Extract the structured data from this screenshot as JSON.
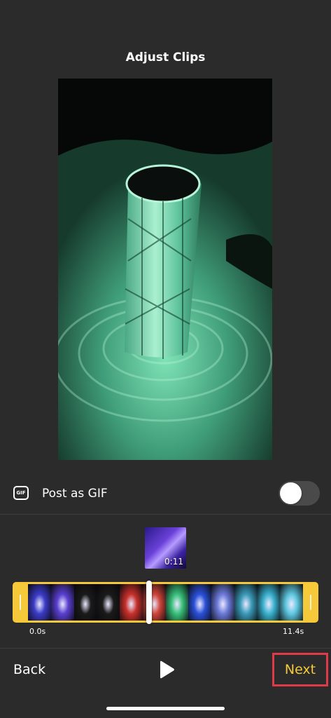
{
  "header": {
    "title": "Adjust Clips"
  },
  "preview": {
    "subject": "crystal lamp video frame"
  },
  "gif_option": {
    "badge": "GIF",
    "label": "Post as GIF",
    "enabled": false
  },
  "clip": {
    "thumb_duration": "0:11"
  },
  "timeline": {
    "start_label": "0.0s",
    "end_label": "11.4s",
    "playhead_fraction": 0.44,
    "frame_colors": [
      "#3b3bc8",
      "#5a3fd0",
      "#1a1a1a",
      "#1a1a1a",
      "#c8302a",
      "#d0453a",
      "#39c07a",
      "#2a50d8",
      "#6b7ad8",
      "#3a9ab8",
      "#3bb3d0",
      "#5ec8e0"
    ]
  },
  "footer": {
    "back_label": "Back",
    "next_label": "Next"
  },
  "colors": {
    "accent": "#f5c93a",
    "highlight_box": "#e03a4a",
    "background": "#2b2b2b"
  }
}
